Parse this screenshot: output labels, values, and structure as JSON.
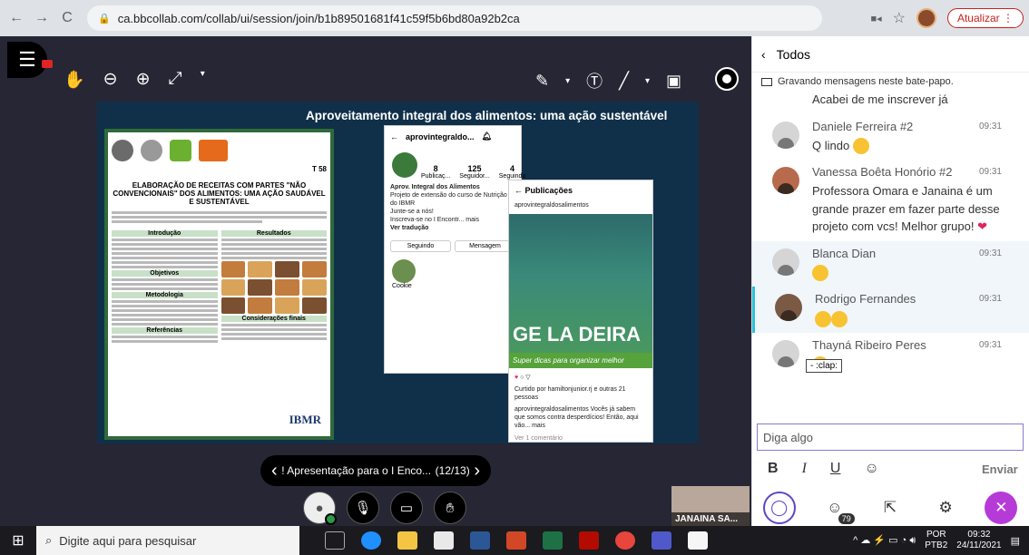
{
  "browser": {
    "back": "←",
    "forward": "→",
    "reload": "C",
    "url": "ca.bbcollab.com/collab/ui/session/join/b1b89501681f41c59f5b6bd80a92b2ca",
    "update_label": "Atualizar"
  },
  "session": {
    "slide_title": "Aproveitamento integral dos alimentos: uma ação sustentável",
    "poster": {
      "title": "ELABORAÇÃO DE RECEITAS COM PARTES \"NÃO CONVENCIONAIS\" DOS ALIMENTOS: UMA AÇÃO SAUDÁVEL E SUSTENTÁVEL",
      "code": "T 58",
      "sec_intro": "Introdução",
      "sec_results": "Resultados",
      "sec_objectives": "Objetivos",
      "sec_method": "Metodologia",
      "sec_final": "Considerações finais",
      "sec_refs": "Referências",
      "brand": "IBMR"
    },
    "phone1": {
      "handle": "aprovintegraldo...",
      "posts": "8",
      "posts_label": "Publicaç...",
      "followers": "125",
      "followers_label": "Seguidor...",
      "following": "4",
      "following_label": "Seguindo",
      "bio1": "Aprov. Integral dos Alimentos",
      "bio2": "Projeto de extensão do curso de Nutrição do IBMR",
      "bio3": "Junte-se a nós!",
      "bio4": "Inscreva-se no I Encontr... mais",
      "bio5": "Ver tradução",
      "btn_following": "Seguindo",
      "btn_message": "Mensagem",
      "highlight": "Cookie"
    },
    "phone2": {
      "header": "Publicações",
      "user": "aprovintegraldosalimentos",
      "gela": "GE LA DEIRA",
      "dicas": "Super dicas para organizar melhor",
      "liked": "Curtido por hamiltonjunior.rj e outras 21 pessoas",
      "caption": "aprovintegraldosalimentos Vocês já sabem que somos contra desperdícios! Então, aqui vão... mais",
      "comments": "Ver 1 comentário"
    },
    "pager": {
      "label": "! Apresentação para o I Enco...",
      "count": "(12/13)"
    },
    "camera_name": "JANAINA SA..."
  },
  "chat": {
    "title": "Todos",
    "recording_note": "Gravando mensagens neste bate-papo.",
    "messages": [
      {
        "name": "",
        "time": "",
        "text": "Acabei de me inscrever já"
      },
      {
        "name": "Daniele Ferreira #2",
        "time": "09:31",
        "text": "Q lindo"
      },
      {
        "name": "Vanessa Boêta Honório #2",
        "time": "09:31",
        "text": "Professora Omara e Janaina é um grande prazer em fazer parte desse projeto com vcs! Melhor grupo!"
      },
      {
        "name": "Blanca Dian",
        "time": "09:31",
        "text": ""
      },
      {
        "name": "Rodrigo Fernandes",
        "time": "09:31",
        "text": ""
      },
      {
        "name": "Thayná Ribeiro Peres",
        "time": "09:31",
        "text": ""
      }
    ],
    "clap_tooltip": "- :clap:",
    "input_placeholder": "Diga algo",
    "send_label": "Enviar",
    "participants_count": "79"
  },
  "taskbar": {
    "search_placeholder": "Digite aqui para pesquisar",
    "lang1": "POR",
    "lang2": "PTB2",
    "time": "09:32",
    "date": "24/11/2021"
  }
}
